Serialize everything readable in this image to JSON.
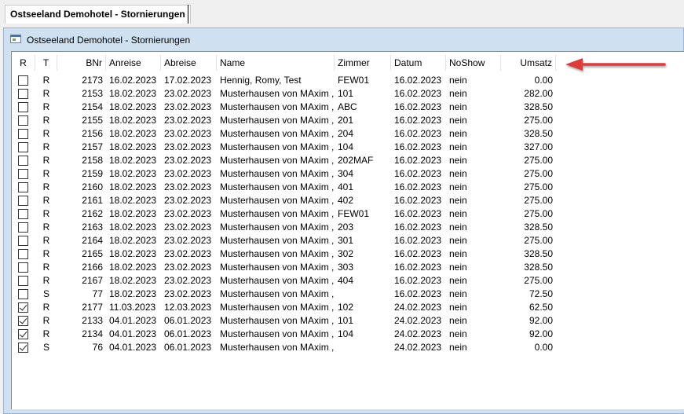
{
  "tab": {
    "label": "Ostseeland Demohotel - Stornierungen"
  },
  "window": {
    "title": "Ostseeland Demohotel - Stornierungen"
  },
  "columns": [
    "R",
    "T",
    "BNr",
    "Anreise",
    "Abreise",
    "Name",
    "Zimmer",
    "Datum",
    "NoShow",
    "Umsatz"
  ],
  "rows": [
    {
      "checked": false,
      "t": "R",
      "bnr": "2173",
      "anreise": "16.02.2023",
      "abreise": "17.02.2023",
      "name": "Hennig, Romy, Test",
      "zimmer": "FEW01",
      "datum": "16.02.2023",
      "noshow": "nein",
      "umsatz": "0.00"
    },
    {
      "checked": false,
      "t": "R",
      "bnr": "2153",
      "anreise": "18.02.2023",
      "abreise": "23.02.2023",
      "name": "Musterhausen von MAxim ,...",
      "zimmer": "101",
      "datum": "16.02.2023",
      "noshow": "nein",
      "umsatz": "282.00"
    },
    {
      "checked": false,
      "t": "R",
      "bnr": "2154",
      "anreise": "18.02.2023",
      "abreise": "23.02.2023",
      "name": "Musterhausen von MAxim ,...",
      "zimmer": "ABC",
      "datum": "16.02.2023",
      "noshow": "nein",
      "umsatz": "328.50"
    },
    {
      "checked": false,
      "t": "R",
      "bnr": "2155",
      "anreise": "18.02.2023",
      "abreise": "23.02.2023",
      "name": "Musterhausen von MAxim ,...",
      "zimmer": "201",
      "datum": "16.02.2023",
      "noshow": "nein",
      "umsatz": "275.00"
    },
    {
      "checked": false,
      "t": "R",
      "bnr": "2156",
      "anreise": "18.02.2023",
      "abreise": "23.02.2023",
      "name": "Musterhausen von MAxim ,...",
      "zimmer": "204",
      "datum": "16.02.2023",
      "noshow": "nein",
      "umsatz": "328.50"
    },
    {
      "checked": false,
      "t": "R",
      "bnr": "2157",
      "anreise": "18.02.2023",
      "abreise": "23.02.2023",
      "name": "Musterhausen von MAxim ,...",
      "zimmer": "104",
      "datum": "16.02.2023",
      "noshow": "nein",
      "umsatz": "327.00"
    },
    {
      "checked": false,
      "t": "R",
      "bnr": "2158",
      "anreise": "18.02.2023",
      "abreise": "23.02.2023",
      "name": "Musterhausen von MAxim ,...",
      "zimmer": "202MAF",
      "datum": "16.02.2023",
      "noshow": "nein",
      "umsatz": "275.00"
    },
    {
      "checked": false,
      "t": "R",
      "bnr": "2159",
      "anreise": "18.02.2023",
      "abreise": "23.02.2023",
      "name": "Musterhausen von MAxim ,...",
      "zimmer": "304",
      "datum": "16.02.2023",
      "noshow": "nein",
      "umsatz": "275.00"
    },
    {
      "checked": false,
      "t": "R",
      "bnr": "2160",
      "anreise": "18.02.2023",
      "abreise": "23.02.2023",
      "name": "Musterhausen von MAxim ,...",
      "zimmer": "401",
      "datum": "16.02.2023",
      "noshow": "nein",
      "umsatz": "275.00"
    },
    {
      "checked": false,
      "t": "R",
      "bnr": "2161",
      "anreise": "18.02.2023",
      "abreise": "23.02.2023",
      "name": "Musterhausen von MAxim ,...",
      "zimmer": "402",
      "datum": "16.02.2023",
      "noshow": "nein",
      "umsatz": "275.00"
    },
    {
      "checked": false,
      "t": "R",
      "bnr": "2162",
      "anreise": "18.02.2023",
      "abreise": "23.02.2023",
      "name": "Musterhausen von MAxim ,...",
      "zimmer": "FEW01",
      "datum": "16.02.2023",
      "noshow": "nein",
      "umsatz": "275.00"
    },
    {
      "checked": false,
      "t": "R",
      "bnr": "2163",
      "anreise": "18.02.2023",
      "abreise": "23.02.2023",
      "name": "Musterhausen von MAxim ,...",
      "zimmer": "203",
      "datum": "16.02.2023",
      "noshow": "nein",
      "umsatz": "328.50"
    },
    {
      "checked": false,
      "t": "R",
      "bnr": "2164",
      "anreise": "18.02.2023",
      "abreise": "23.02.2023",
      "name": "Musterhausen von MAxim ,...",
      "zimmer": "301",
      "datum": "16.02.2023",
      "noshow": "nein",
      "umsatz": "275.00"
    },
    {
      "checked": false,
      "t": "R",
      "bnr": "2165",
      "anreise": "18.02.2023",
      "abreise": "23.02.2023",
      "name": "Musterhausen von MAxim ,...",
      "zimmer": "302",
      "datum": "16.02.2023",
      "noshow": "nein",
      "umsatz": "328.50"
    },
    {
      "checked": false,
      "t": "R",
      "bnr": "2166",
      "anreise": "18.02.2023",
      "abreise": "23.02.2023",
      "name": "Musterhausen von MAxim ,...",
      "zimmer": "303",
      "datum": "16.02.2023",
      "noshow": "nein",
      "umsatz": "328.50"
    },
    {
      "checked": false,
      "t": "R",
      "bnr": "2167",
      "anreise": "18.02.2023",
      "abreise": "23.02.2023",
      "name": "Musterhausen von MAxim ,...",
      "zimmer": "404",
      "datum": "16.02.2023",
      "noshow": "nein",
      "umsatz": "275.00"
    },
    {
      "checked": false,
      "t": "S",
      "bnr": "77",
      "anreise": "18.02.2023",
      "abreise": "23.02.2023",
      "name": "Musterhausen von MAxim ,...",
      "zimmer": "",
      "datum": "16.02.2023",
      "noshow": "nein",
      "umsatz": "72.50"
    },
    {
      "checked": true,
      "t": "R",
      "bnr": "2177",
      "anreise": "11.03.2023",
      "abreise": "12.03.2023",
      "name": "Musterhausen von MAxim ,...",
      "zimmer": "102",
      "datum": "24.02.2023",
      "noshow": "nein",
      "umsatz": "62.50"
    },
    {
      "checked": true,
      "t": "R",
      "bnr": "2133",
      "anreise": "04.01.2023",
      "abreise": "06.01.2023",
      "name": "Musterhausen von MAxim ,...",
      "zimmer": "101",
      "datum": "24.02.2023",
      "noshow": "nein",
      "umsatz": "92.00"
    },
    {
      "checked": true,
      "t": "R",
      "bnr": "2134",
      "anreise": "04.01.2023",
      "abreise": "06.01.2023",
      "name": "Musterhausen von MAxim ,...",
      "zimmer": "104",
      "datum": "24.02.2023",
      "noshow": "nein",
      "umsatz": "92.00"
    },
    {
      "checked": true,
      "t": "S",
      "bnr": "76",
      "anreise": "04.01.2023",
      "abreise": "06.01.2023",
      "name": "Musterhausen von MAxim ,...",
      "zimmer": "",
      "datum": "24.02.2023",
      "noshow": "nein",
      "umsatz": "0.00"
    }
  ],
  "annotation": {
    "arrow_color": "#e03a3a",
    "icon": "arrow-left-icon"
  }
}
